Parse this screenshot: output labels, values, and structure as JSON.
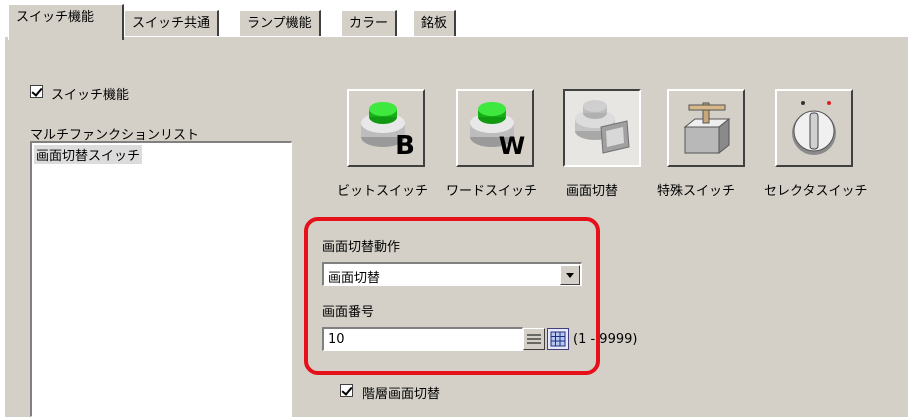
{
  "tabs": [
    {
      "label": "スイッチ機能",
      "active": true
    },
    {
      "label": "スイッチ共通",
      "active": false
    },
    {
      "label": "ランプ機能",
      "active": false
    },
    {
      "label": "カラー",
      "active": false
    },
    {
      "label": "銘板",
      "active": false
    }
  ],
  "switch_function": {
    "label": "スイッチ機能",
    "checked": true
  },
  "multifunction_list": {
    "label": "マルチファンクションリスト",
    "items": [
      "画面切替スイッチ"
    ]
  },
  "function_buttons": [
    {
      "label": "ビットスイッチ",
      "icon": "bit-switch-icon",
      "letter": "B",
      "pressed": false
    },
    {
      "label": "ワードスイッチ",
      "icon": "word-switch-icon",
      "letter": "W",
      "pressed": false
    },
    {
      "label": "画面切替",
      "icon": "screen-change-icon",
      "letter": "",
      "pressed": true
    },
    {
      "label": "特殊スイッチ",
      "icon": "special-switch-icon",
      "letter": "",
      "pressed": false
    },
    {
      "label": "セレクタスイッチ",
      "icon": "selector-switch-icon",
      "letter": "",
      "pressed": false
    }
  ],
  "screen_change_action": {
    "label": "画面切替動作",
    "value": "画面切替"
  },
  "screen_number": {
    "label": "画面番号",
    "value": "10",
    "range": "(1 - 9999)"
  },
  "hierarchy_screen_change": {
    "label": "階層画面切替",
    "checked": true
  },
  "colors": {
    "highlight": "#e5101a",
    "panel": "#d4d0c8",
    "green": "#22cc22"
  }
}
